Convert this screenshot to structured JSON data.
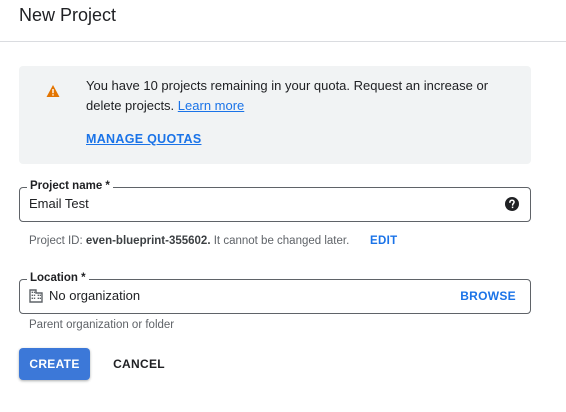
{
  "header": {
    "title": "New Project"
  },
  "quota_banner": {
    "icon": "warning-icon",
    "icon_color": "#e37400",
    "message": "You have 10 projects remaining in your quota. Request an increase or delete projects.",
    "learn_more_label": "Learn more",
    "manage_quotas_label": "MANAGE QUOTAS"
  },
  "project_name": {
    "label": "Project name *",
    "value": "Email Test",
    "help_icon": "help-icon"
  },
  "project_id": {
    "prefix": "Project ID:",
    "id": "even-blueprint-355602.",
    "suffix": "It cannot be changed later.",
    "edit_label": "EDIT"
  },
  "location": {
    "label": "Location *",
    "value": "No organization",
    "icon": "building-icon",
    "browse_label": "BROWSE",
    "hint": "Parent organization or folder"
  },
  "actions": {
    "create_label": "CREATE",
    "cancel_label": "CANCEL"
  },
  "colors": {
    "accent": "#1a73e8",
    "primary_button": "#3c78d8",
    "banner_bg": "#f1f3f4"
  }
}
